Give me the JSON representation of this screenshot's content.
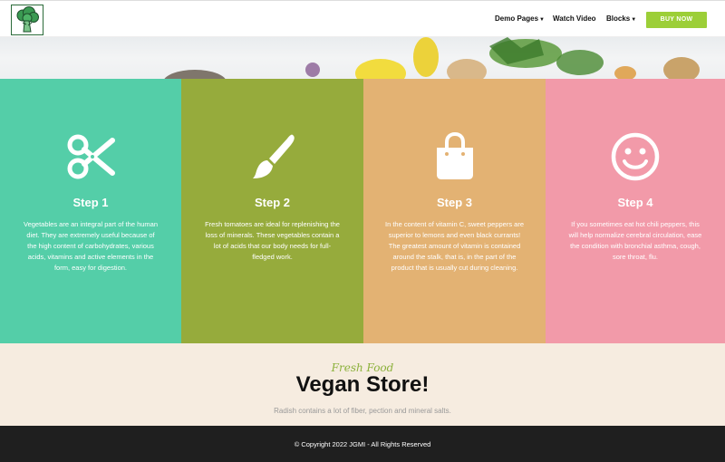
{
  "nav": {
    "items": [
      {
        "label": "Demo Pages",
        "has_caret": true
      },
      {
        "label": "Watch Video",
        "has_caret": false
      },
      {
        "label": "Blocks",
        "has_caret": true
      }
    ],
    "buy_label": "BUY NOW",
    "logo_icon": "broccoli-icon"
  },
  "steps": [
    {
      "title": "Step 1",
      "icon": "scissors-icon",
      "color": "#54cea8",
      "text": "Vegetables are an integral part of the human diet. They are extremely useful because of the high content of carbohydrates, various acids, vitamins and active elements in the form, easy for digestion."
    },
    {
      "title": "Step 2",
      "icon": "paintbrush-icon",
      "color": "#96ab3c",
      "text": "Fresh tomatoes are ideal for replenishing the loss of minerals. These vegetables contain a lot of acids that our body needs for full-fledged work."
    },
    {
      "title": "Step 3",
      "icon": "shopping-bag-icon",
      "color": "#e3b273",
      "text": "In the content of vitamin C, sweet peppers are superior to lemons and even black currants! The greatest amount of vitamin is contained around the stalk, that is, in the part of the product that is usually cut during cleaning."
    },
    {
      "title": "Step 4",
      "icon": "smiley-icon",
      "color": "#f29aa9",
      "text": "If you sometimes eat hot chili peppers, this will help normalize cerebral circulation, ease the condition with bronchial asthma, cough, sore throat, flu."
    }
  ],
  "store": {
    "subtitle": "Fresh Food",
    "title": "Vegan Store!",
    "description": "Radish contains a lot of fiber, pection and mineral salts."
  },
  "footer": {
    "copyright": "© Copyright 2022 JGMI - All Rights Reserved"
  },
  "colors": {
    "accent": "#9ccf38",
    "footer_bg": "#1f1f1f",
    "store_bg": "#f6ece0"
  }
}
